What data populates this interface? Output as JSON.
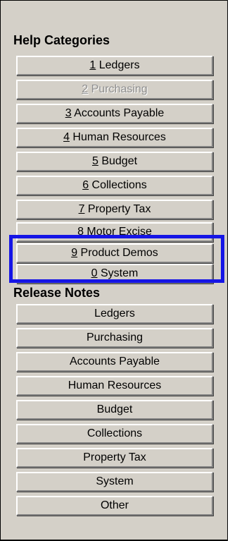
{
  "help": {
    "title": "Help Categories",
    "items": [
      {
        "key": "1",
        "label": " Ledgers",
        "enabled": true
      },
      {
        "key": "2",
        "label": " Purchasing",
        "enabled": false
      },
      {
        "key": "3",
        "label": " Accounts Payable",
        "enabled": true
      },
      {
        "key": "4",
        "label": " Human Resources",
        "enabled": true
      },
      {
        "key": "5",
        "label": " Budget",
        "enabled": true
      },
      {
        "key": "6",
        "label": " Collections",
        "enabled": true
      },
      {
        "key": "7",
        "label": " Property Tax",
        "enabled": true
      },
      {
        "key": "8",
        "label": " Motor Excise",
        "enabled": true
      },
      {
        "key": "9",
        "label": " Product Demos",
        "enabled": true
      },
      {
        "key": "0",
        "label": " System",
        "enabled": true
      }
    ]
  },
  "release": {
    "title": "Release Notes",
    "items": [
      "Ledgers",
      "Purchasing",
      "Accounts Payable",
      "Human Resources",
      "Budget",
      "Collections",
      "Property Tax",
      "System",
      "Other"
    ]
  },
  "colors": {
    "panel": "#d4d0c8",
    "highlight": "#1515e6",
    "disabled_text": "#8e8e8e"
  }
}
